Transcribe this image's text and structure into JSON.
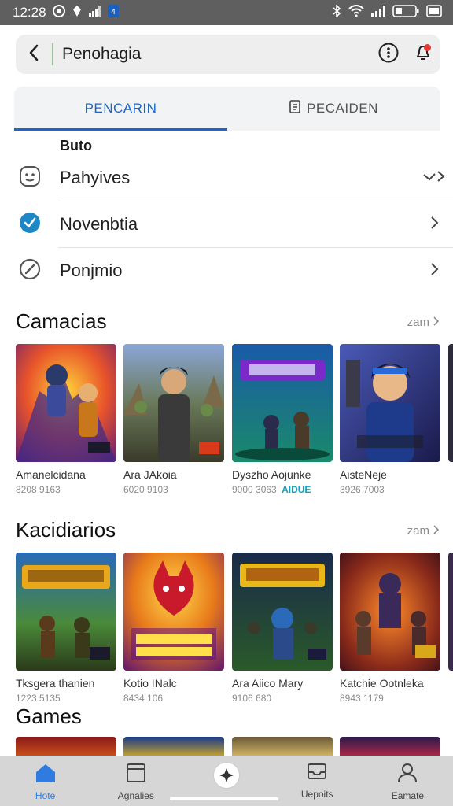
{
  "status_bar": {
    "time": "12:28",
    "icons_left": [
      "record-icon",
      "pin-icon",
      "signal-bars-icon",
      "app-badge-icon"
    ],
    "icons_right": [
      "bluetooth-icon",
      "wifi-icon",
      "signal-icon",
      "battery-icon",
      "screen-icon"
    ]
  },
  "search": {
    "text": "Penohagia"
  },
  "tabs": [
    {
      "label": "PENCARIN",
      "active": true
    },
    {
      "label": "PECAIDEN",
      "active": false,
      "icon": "document-icon"
    }
  ],
  "settings": {
    "heading": "Buto",
    "items": [
      {
        "label": "Pahyives",
        "icon": "face-icon",
        "chevron": "double-chevron-icon"
      },
      {
        "label": "Novenbtia",
        "icon": "check-circle-icon",
        "chevron": "chevron-right-icon"
      },
      {
        "label": "Ponjmio",
        "icon": "slash-circle-icon",
        "chevron": "chevron-right-icon"
      }
    ]
  },
  "sections": [
    {
      "title": "Camacias",
      "more": "zam",
      "cards": [
        {
          "title": "Amanelcidana",
          "meta": "8208 9163",
          "badge": ""
        },
        {
          "title": "Ara JAkoia",
          "meta": "6020 9103",
          "badge": ""
        },
        {
          "title": "Dyszho Aojunke",
          "meta": "9000 3063",
          "badge": "AIDUE"
        },
        {
          "title": "AisteNeje",
          "meta": "3926 7003",
          "badge": ""
        }
      ]
    },
    {
      "title": "Kacidiarios",
      "more": "zam",
      "cards": [
        {
          "title": "Tksgera thanien",
          "meta": "1223 5135",
          "badge": ""
        },
        {
          "title": "Kotio INalc",
          "meta": "8434 106",
          "badge": ""
        },
        {
          "title": "Ara Aiico Mary",
          "meta": "9106 680",
          "badge": ""
        },
        {
          "title": "Katchie Ootnleka",
          "meta": "8943 1179",
          "badge": ""
        }
      ]
    }
  ],
  "games_title": "Games",
  "bottom_nav": [
    {
      "label": "Hote",
      "icon": "home-icon",
      "active": true
    },
    {
      "label": "Agnalies",
      "icon": "window-icon",
      "active": false
    },
    {
      "label": "",
      "icon": "compass-icon",
      "active": false
    },
    {
      "label": "Uepoits",
      "icon": "inbox-icon",
      "active": false
    },
    {
      "label": "Eamate",
      "icon": "profile-icon",
      "active": false
    }
  ],
  "colors": {
    "accent": "#1a66c9",
    "status_bar": "#5f5f5f",
    "nav_bg": "#d6d6d6",
    "notif": "#e53935",
    "check": "#1e88c7"
  }
}
